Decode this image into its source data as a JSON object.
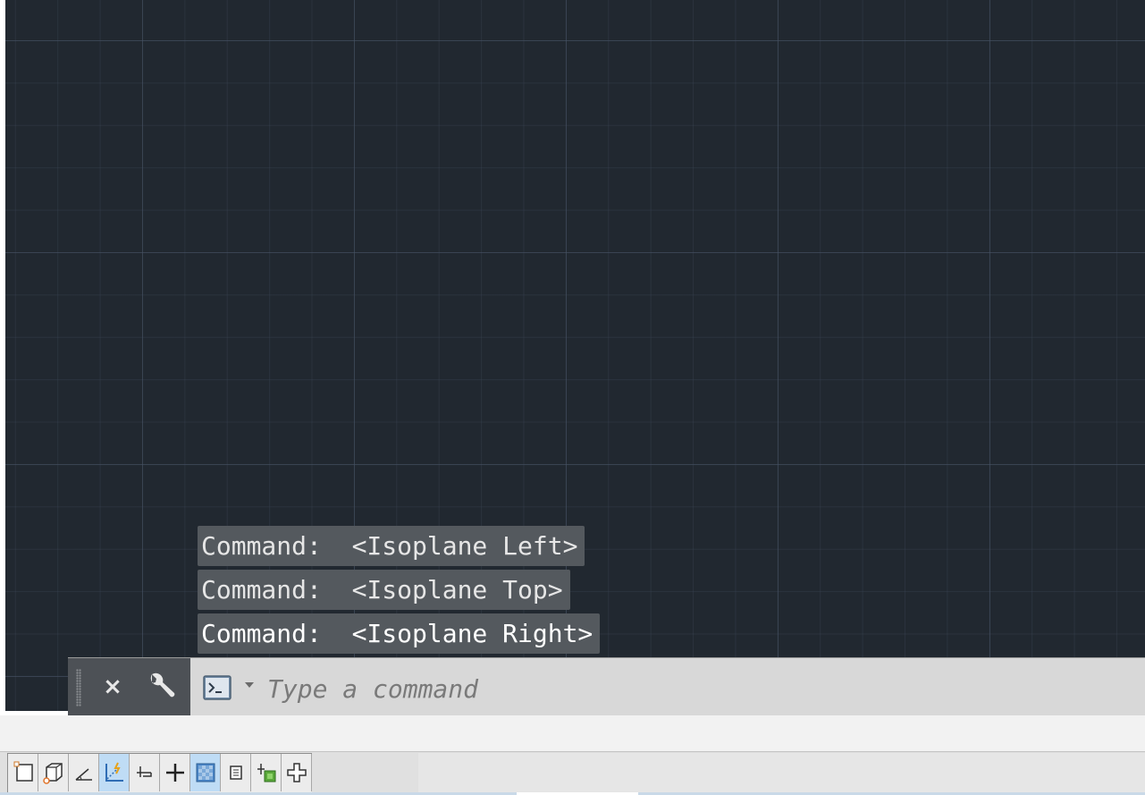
{
  "command_history": [
    "Command:  <Isoplane Left>",
    "Command:  <Isoplane Top>",
    "Command:  <Isoplane Right>"
  ],
  "command_line": {
    "placeholder": "Type a command",
    "value": "",
    "close_label": "×"
  },
  "status_bar": {
    "icons": [
      {
        "name": "isodraft-icon",
        "active": false
      },
      {
        "name": "model-space-icon",
        "active": false
      },
      {
        "name": "polar-tracking-icon",
        "active": false
      },
      {
        "name": "object-snap-tracking-icon",
        "active": true
      },
      {
        "name": "2d-object-snap-icon",
        "active": false
      },
      {
        "name": "lineweight-icon",
        "active": false
      },
      {
        "name": "transparency-icon",
        "active": true
      },
      {
        "name": "selection-cycling-icon",
        "active": false
      },
      {
        "name": "3d-object-snap-icon",
        "active": false
      },
      {
        "name": "dynamic-ucs-icon",
        "active": false
      }
    ]
  },
  "colors": {
    "canvas_background": "#212830",
    "grid_line": "#465264",
    "history_background": "#54595e",
    "command_bar": "#d8d8d8",
    "active_toggle": "#bfdcf5"
  }
}
